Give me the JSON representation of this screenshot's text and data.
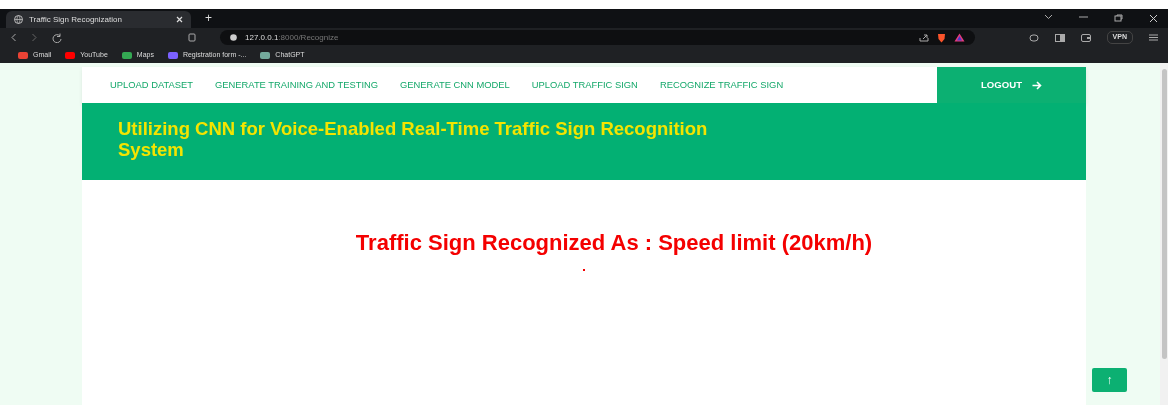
{
  "browser": {
    "tabs": [
      {
        "title": "Traffic Sign Recognization",
        "selected": true
      }
    ],
    "new_tab": "+",
    "url_host": "127.0.0.1",
    "url_path": ":8000/Recognize",
    "vpn": "VPN",
    "bookmarks": [
      {
        "label": "Gmail",
        "color": "#ea4335"
      },
      {
        "label": "YouTube",
        "color": "#ff0000"
      },
      {
        "label": "Maps",
        "color": "#34a853"
      },
      {
        "label": "Registration form -...",
        "color": "#7b61ff"
      },
      {
        "label": "ChatGPT",
        "color": "#74aa9c"
      }
    ]
  },
  "nav": {
    "items": [
      {
        "label": "UPLOAD DATASET",
        "selected": false
      },
      {
        "label": "GENERATE TRAINING AND TESTING",
        "selected": false
      },
      {
        "label": "GENERATE CNN MODEL",
        "selected": false
      },
      {
        "label": "UPLOAD TRAFFIC SIGN",
        "selected": false
      },
      {
        "label": "RECOGNIZE TRAFFIC SIGN",
        "selected": false
      }
    ],
    "logout": "LOGOUT"
  },
  "header": {
    "title": "Utilizing CNN for Voice-Enabled Real-Time Traffic Sign Recognition System"
  },
  "result": {
    "text": "Traffic Sign Recognized As : Speed limit (20km/h)"
  },
  "back_to_top": "↑"
}
